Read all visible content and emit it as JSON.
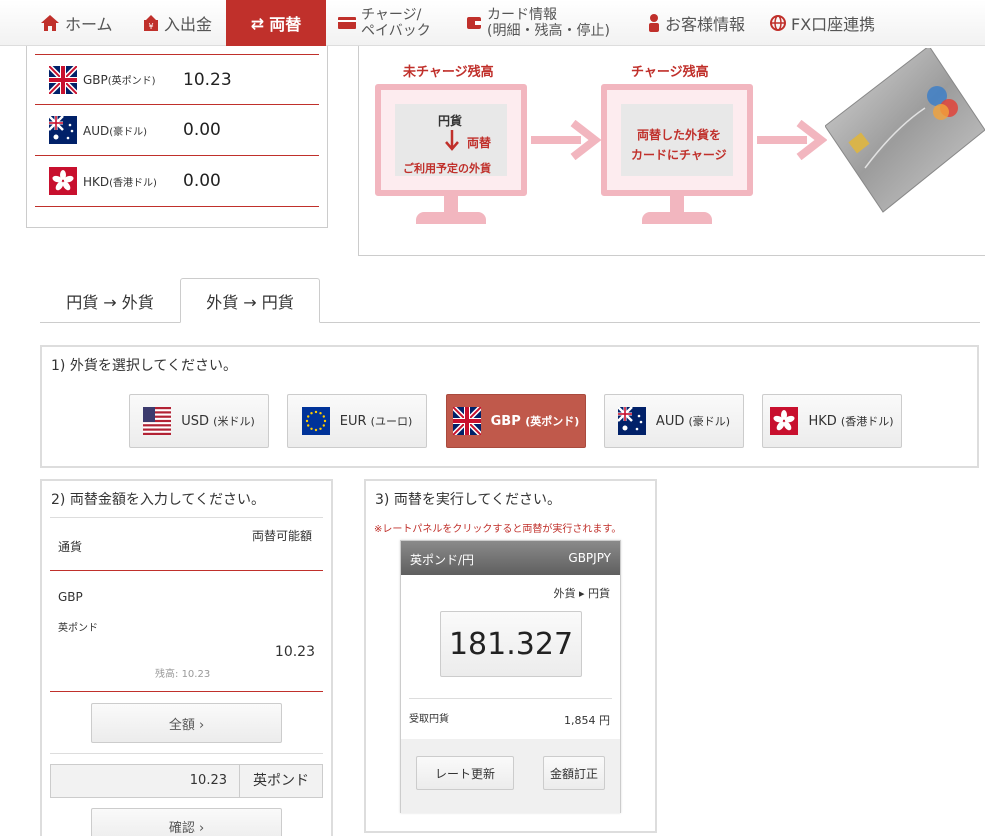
{
  "nav": {
    "home": "ホーム",
    "deposit": "入出金",
    "exchange": "両替",
    "charge_line1": "チャージ/",
    "charge_line2": "ペイバック",
    "card_line1": "カード情報",
    "card_line2": "(明細・残高・停止)",
    "customer": "お客様情報",
    "fx": "FX口座連携"
  },
  "balances": [
    {
      "code": "GBP",
      "name": "(英ポンド)",
      "amount": "10.23"
    },
    {
      "code": "AUD",
      "name": "(豪ドル)",
      "amount": "0.00"
    },
    {
      "code": "HKD",
      "name": "(香港ドル)",
      "amount": "0.00"
    }
  ],
  "diagram": {
    "left_title": "未チャージ残高",
    "right_title": "チャージ残高",
    "left_top": "円貨",
    "left_side": "両替",
    "left_bottom": "ご利用予定の外貨",
    "right_line1": "両替した外貨を",
    "right_line2": "カードにチャージ"
  },
  "tabs": {
    "tab1": "円貨 → 外貨",
    "tab2": "外貨 → 円貨"
  },
  "step1": {
    "title": "1) 外貨を選択してください。",
    "currencies": [
      {
        "code": "USD",
        "name": "(米ドル)"
      },
      {
        "code": "EUR",
        "name": "(ユーロ)"
      },
      {
        "code": "GBP",
        "name": "(英ポンド)"
      },
      {
        "code": "AUD",
        "name": "(豪ドル)"
      },
      {
        "code": "HKD",
        "name": "(香港ドル)"
      }
    ]
  },
  "step2": {
    "title": "2) 両替金額を入力してください。",
    "col_currency": "通貨",
    "col_available": "両替可能額",
    "currency_code": "GBP",
    "currency_name": "英ポンド",
    "available": "10.23",
    "balance_label": "残高:",
    "balance_value": "10.23",
    "all_button": "全額 ›",
    "amount_value": "10.23",
    "amount_unit": "英ポンド",
    "confirm_button": "確認 ›"
  },
  "step3": {
    "title": "3) 両替を実行してください。",
    "note": "※レートパネルをクリックすると両替が実行されます。",
    "pair_name": "英ポンド/円",
    "pair_code": "GBPJPY",
    "direction": "外貨 ▸ 円貨",
    "rate": "181.327",
    "receive_label": "受取円貨",
    "receive_value": "1,854 円",
    "refresh_button": "レート更新",
    "correct_button": "金額訂正"
  },
  "colors": {
    "accent": "#c0302b",
    "selected": "#c0594b"
  }
}
